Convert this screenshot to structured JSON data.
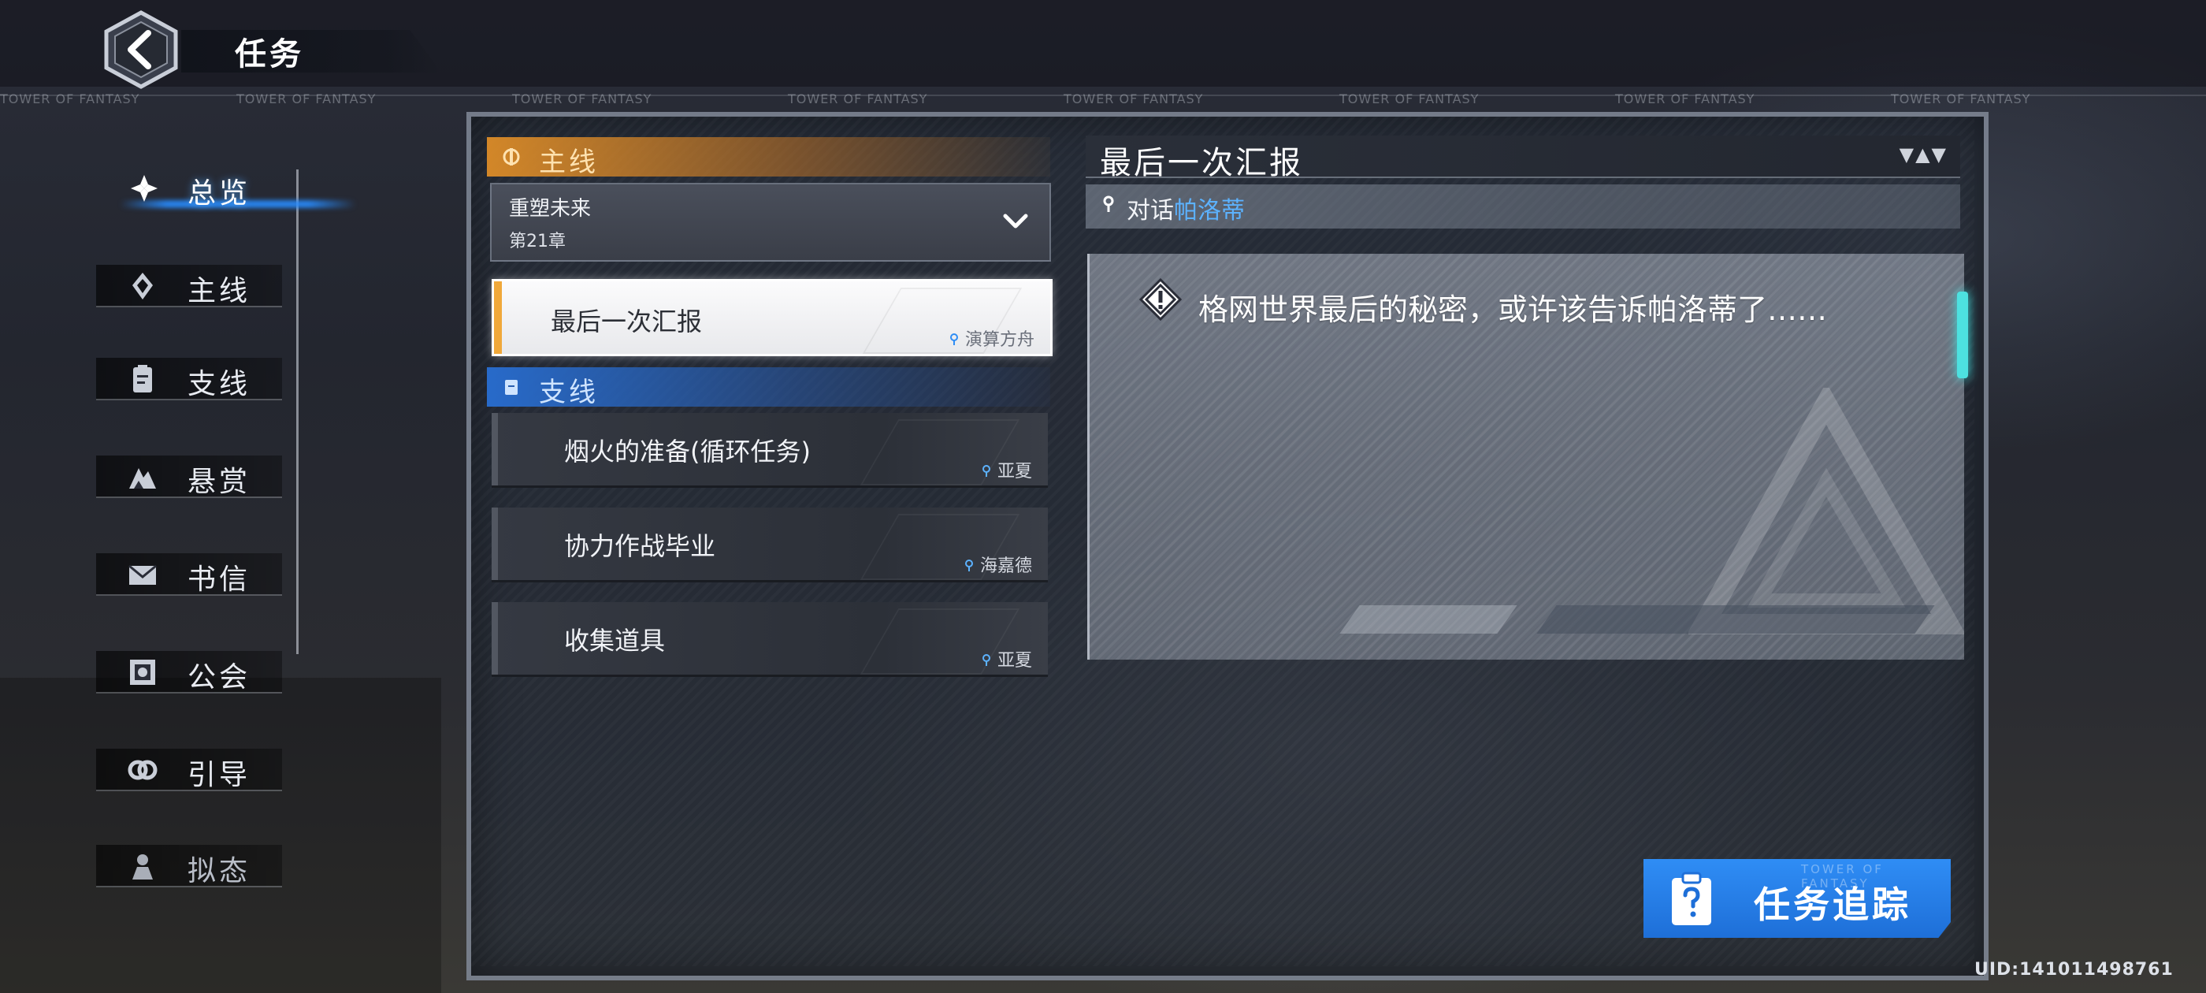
{
  "header": {
    "title": "任务",
    "back_icon": "chevron-left-icon"
  },
  "watermark": "TOWER OF FANTASY",
  "nav": {
    "items": [
      {
        "label": "总览",
        "icon": "overview-icon",
        "active": true
      },
      {
        "label": "主线",
        "icon": "main-quest-icon",
        "active": false
      },
      {
        "label": "支线",
        "icon": "side-quest-icon",
        "active": false
      },
      {
        "label": "悬赏",
        "icon": "bounty-icon",
        "active": false
      },
      {
        "label": "书信",
        "icon": "mail-icon",
        "active": false
      },
      {
        "label": "公会",
        "icon": "guild-icon",
        "active": false
      },
      {
        "label": "引导",
        "icon": "guide-icon",
        "active": false
      },
      {
        "label": "拟态",
        "icon": "simulacra-icon",
        "active": false
      }
    ]
  },
  "main_section": {
    "label": "主线",
    "chapter_name": "重塑未来",
    "chapter_number": "第21章",
    "quests": [
      {
        "name": "最后一次汇报",
        "location": "演算方舟",
        "selected": true
      }
    ]
  },
  "side_section": {
    "label": "支线",
    "quests": [
      {
        "name": "烟火的准备(循环任务)",
        "location": "亚夏"
      },
      {
        "name": "协力作战毕业",
        "location": "海嘉德"
      },
      {
        "name": "收集道具",
        "location": "亚夏"
      }
    ]
  },
  "detail": {
    "title": "最后一次汇报",
    "arrows": "▼▲▼",
    "objective_prefix": "对话",
    "objective_npc": "帕洛蒂",
    "description": "格网世界最后的秘密，或许该告诉帕洛蒂了……"
  },
  "track_button": {
    "label": "任务追踪",
    "icon": "clipboard-question-icon"
  },
  "uid": "UID:141011498761",
  "colors": {
    "main_accent": "#f0a83a",
    "side_accent": "#2f8df5",
    "npc_highlight": "#5cb2ff",
    "scroll_tab": "#4de1e0"
  }
}
